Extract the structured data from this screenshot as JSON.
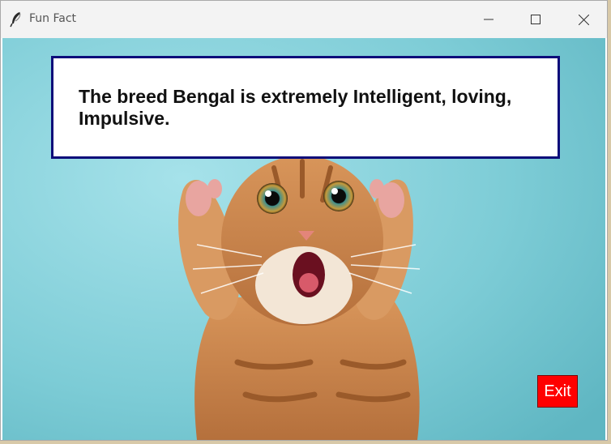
{
  "window": {
    "title": "Fun Fact",
    "icon": "feather-icon",
    "controls": [
      "minimize-icon",
      "maximize-icon",
      "close-icon"
    ]
  },
  "fact": {
    "text": "The breed Bengal is extremely Intelligent, loving, Impulsive."
  },
  "buttons": {
    "exit_label": "Exit"
  },
  "colors": {
    "background": "#7fcfd8",
    "box_border": "#0d0d7a",
    "exit_button": "#ff0000"
  }
}
